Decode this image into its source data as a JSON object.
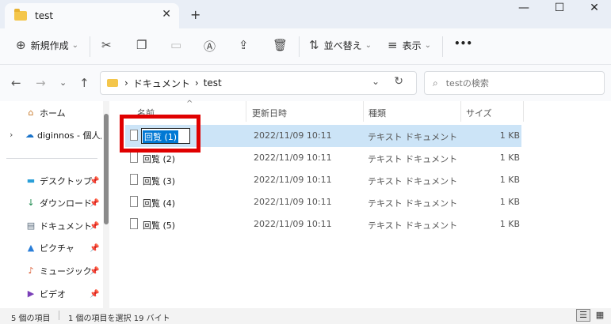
{
  "tab": {
    "title": "test",
    "close_icon": "✕",
    "new_tab_icon": "+"
  },
  "window": {
    "minimize": "—",
    "maximize": "☐",
    "close": "✕"
  },
  "toolbar": {
    "new_label": "新規作成",
    "new_chevron": "⌄",
    "sort_label": "並べ替え",
    "view_label": "表示",
    "more_label": "•••"
  },
  "address": {
    "root_chevron": "›",
    "folder1": "ドキュメント",
    "sep": "›",
    "folder2": "test"
  },
  "search": {
    "placeholder": "testの検索"
  },
  "sidebar": {
    "items": [
      {
        "label": "ホーム",
        "icon": "⌂"
      },
      {
        "label": "diginnos - 個人用",
        "icon": "☁"
      },
      {
        "label": "デスクトップ",
        "icon": "▬"
      },
      {
        "label": "ダウンロード",
        "icon": "↓"
      },
      {
        "label": "ドキュメント",
        "icon": "▤"
      },
      {
        "label": "ピクチャ",
        "icon": "▲"
      },
      {
        "label": "ミュージック",
        "icon": "♪"
      },
      {
        "label": "ビデオ",
        "icon": "▶"
      }
    ],
    "expand_icon": "›",
    "pin_icon": "📌"
  },
  "columns": {
    "name": "名前",
    "modified": "更新日時",
    "type": "種類",
    "size": "サイズ"
  },
  "files": [
    {
      "name": "回覧 (1)",
      "date": "2022/11/09 10:11",
      "type": "テキスト ドキュメント",
      "size": "1 KB"
    },
    {
      "name": "回覧 (2)",
      "date": "2022/11/09 10:11",
      "type": "テキスト ドキュメント",
      "size": "1 KB"
    },
    {
      "name": "回覧 (3)",
      "date": "2022/11/09 10:11",
      "type": "テキスト ドキュメント",
      "size": "1 KB"
    },
    {
      "name": "回覧 (4)",
      "date": "2022/11/09 10:11",
      "type": "テキスト ドキュメント",
      "size": "1 KB"
    },
    {
      "name": "回覧 (5)",
      "date": "2022/11/09 10:11",
      "type": "テキスト ドキュメント",
      "size": "1 KB"
    }
  ],
  "rename_value": "回覧 (1)",
  "status": {
    "count": "5 個の項目",
    "selection": "1 個の項目を選択  19 バイト"
  },
  "colors": {
    "selection": "#cce4f7",
    "highlight_border": "#e00000",
    "accent": "#0078d4"
  }
}
